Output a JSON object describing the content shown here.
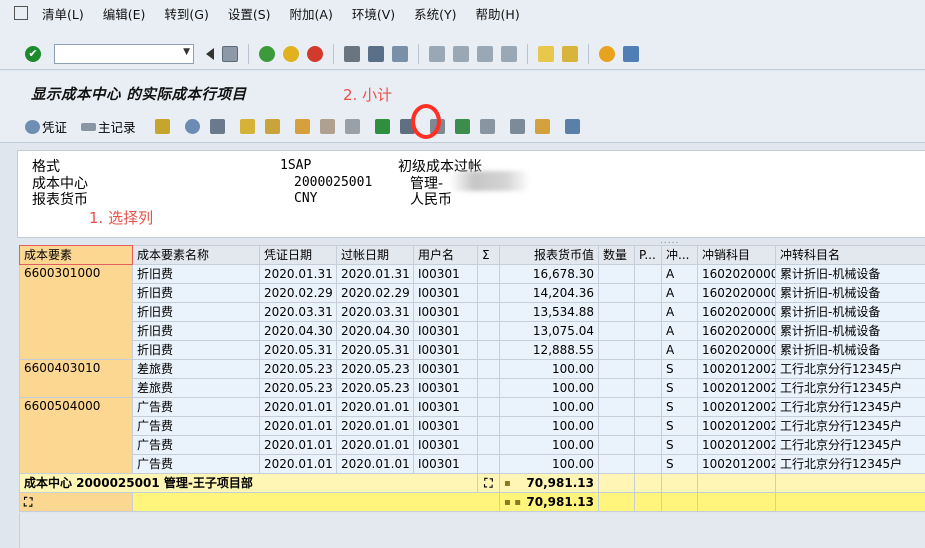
{
  "menu": [
    "清单(L)",
    "编辑(E)",
    "转到(G)",
    "设置(S)",
    "附加(A)",
    "环境(V)",
    "系统(Y)",
    "帮助(H)"
  ],
  "title": "显示成本中心 的实际成本行项目",
  "annotations": {
    "select_column": "1. 选择列",
    "subtotal": "2. 小计"
  },
  "app_toolbar": {
    "voucher": "凭证",
    "master_record": "主记录"
  },
  "header": {
    "layout_label": "格式",
    "layout_value": "1SAP",
    "layout_desc": "初级成本过帐",
    "cc_label": "成本中心",
    "cc_value": "2000025001",
    "cc_desc": "管理-",
    "currency_label": "报表货币",
    "currency_value": "CNY",
    "currency_desc": "人民币"
  },
  "columns": [
    "成本要素",
    "成本要素名称",
    "凭证日期",
    "过帐日期",
    "用户名",
    "Σ",
    "报表货币值",
    "数量",
    "P...",
    "冲...",
    "冲销科目",
    "冲转科目名"
  ],
  "groups": [
    {
      "key": "6600301000",
      "rows": [
        [
          "折旧费",
          "2020.01.31",
          "2020.01.31",
          "I00301",
          "16,678.30",
          "A",
          "1602020000",
          "累计折旧-机械设备"
        ],
        [
          "折旧费",
          "2020.02.29",
          "2020.02.29",
          "I00301",
          "14,204.36",
          "A",
          "1602020000",
          "累计折旧-机械设备"
        ],
        [
          "折旧费",
          "2020.03.31",
          "2020.03.31",
          "I00301",
          "13,534.88",
          "A",
          "1602020000",
          "累计折旧-机械设备"
        ],
        [
          "折旧费",
          "2020.04.30",
          "2020.04.30",
          "I00301",
          "13,075.04",
          "A",
          "1602020000",
          "累计折旧-机械设备"
        ],
        [
          "折旧费",
          "2020.05.31",
          "2020.05.31",
          "I00301",
          "12,888.55",
          "A",
          "1602020000",
          "累计折旧-机械设备"
        ]
      ]
    },
    {
      "key": "6600403010",
      "rows": [
        [
          "差旅费",
          "2020.05.23",
          "2020.05.23",
          "I00301",
          "100.00",
          "S",
          "1002012002",
          "工行北京分行12345户"
        ],
        [
          "差旅费",
          "2020.05.23",
          "2020.05.23",
          "I00301",
          "100.00",
          "S",
          "1002012002",
          "工行北京分行12345户"
        ]
      ]
    },
    {
      "key": "6600504000",
      "rows": [
        [
          "广告费",
          "2020.01.01",
          "2020.01.01",
          "I00301",
          "100.00",
          "S",
          "1002012002",
          "工行北京分行12345户"
        ],
        [
          "广告费",
          "2020.01.01",
          "2020.01.01",
          "I00301",
          "100.00",
          "S",
          "1002012002",
          "工行北京分行12345户"
        ],
        [
          "广告费",
          "2020.01.01",
          "2020.01.01",
          "I00301",
          "100.00",
          "S",
          "1002012002",
          "工行北京分行12345户"
        ],
        [
          "广告费",
          "2020.01.01",
          "2020.01.01",
          "I00301",
          "100.00",
          "S",
          "1002012002",
          "工行北京分行12345户"
        ]
      ]
    }
  ],
  "subtotal": {
    "label": "成本中心 2000025001 管理-王子项目部",
    "value": "70,981.13"
  },
  "total": {
    "value": "70,981.13"
  }
}
